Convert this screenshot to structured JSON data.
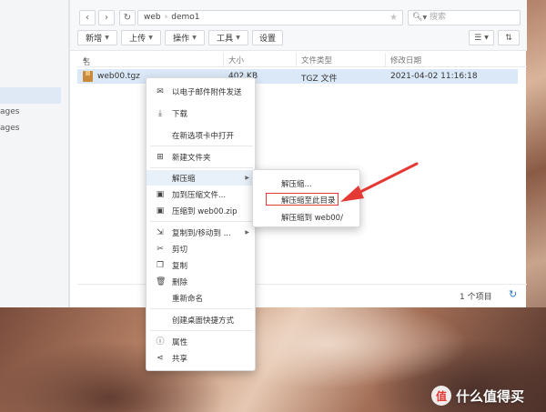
{
  "sidebar": {
    "items": [
      "ages",
      "ages"
    ]
  },
  "toolbar": {
    "back_icon": "chevron-left-icon",
    "forward_icon": "chevron-right-icon",
    "refresh_icon": "refresh-icon",
    "path": [
      "web",
      "demo1"
    ],
    "search_placeholder": "搜索",
    "buttons": [
      {
        "label": "新增",
        "dropdown": true
      },
      {
        "label": "上传",
        "dropdown": true
      },
      {
        "label": "操作",
        "dropdown": true
      },
      {
        "label": "工具",
        "dropdown": true
      },
      {
        "label": "设置",
        "dropdown": false
      }
    ]
  },
  "columns": [
    "名称",
    "大小",
    "文件类型",
    "修改日期"
  ],
  "file": {
    "name": "web00.tgz",
    "size": "402 KB",
    "type": "TGZ 文件",
    "modified": "2021-04-02 11:16:18"
  },
  "footer": {
    "count": "1 个项目"
  },
  "context_menu": {
    "items": [
      {
        "icon": "mail-icon",
        "label": "以电子邮件附件发送"
      },
      {
        "icon": "download-icon",
        "label": "下载"
      },
      {
        "icon": "",
        "label": "在新选项卡中打开"
      },
      {
        "icon": "new-folder-icon",
        "label": "新建文件夹"
      },
      {
        "icon": "",
        "label": "解压缩",
        "submenu": true,
        "highlighted": true
      },
      {
        "icon": "archive-icon",
        "label": "加到压缩文件..."
      },
      {
        "icon": "zip-icon",
        "label": "压缩到 web00.zip"
      },
      {
        "icon": "copy-move-icon",
        "label": "复制到/移动到 ...",
        "submenu": true
      },
      {
        "icon": "scissors-icon",
        "label": "剪切"
      },
      {
        "icon": "copy-icon",
        "label": "复制"
      },
      {
        "icon": "trash-icon",
        "label": "删除"
      },
      {
        "icon": "",
        "label": "重新命名"
      },
      {
        "icon": "",
        "label": "创建桌面快捷方式"
      },
      {
        "icon": "info-icon",
        "label": "属性"
      },
      {
        "icon": "share-icon",
        "label": "共享"
      }
    ]
  },
  "submenu": {
    "items": [
      "解压缩...",
      "解压缩至此目录",
      "解压缩到 web00/"
    ],
    "annotated_index": 1
  },
  "annotation": {
    "color": "#e53935"
  },
  "watermark": {
    "badge": "值",
    "text": "什么值得买"
  }
}
